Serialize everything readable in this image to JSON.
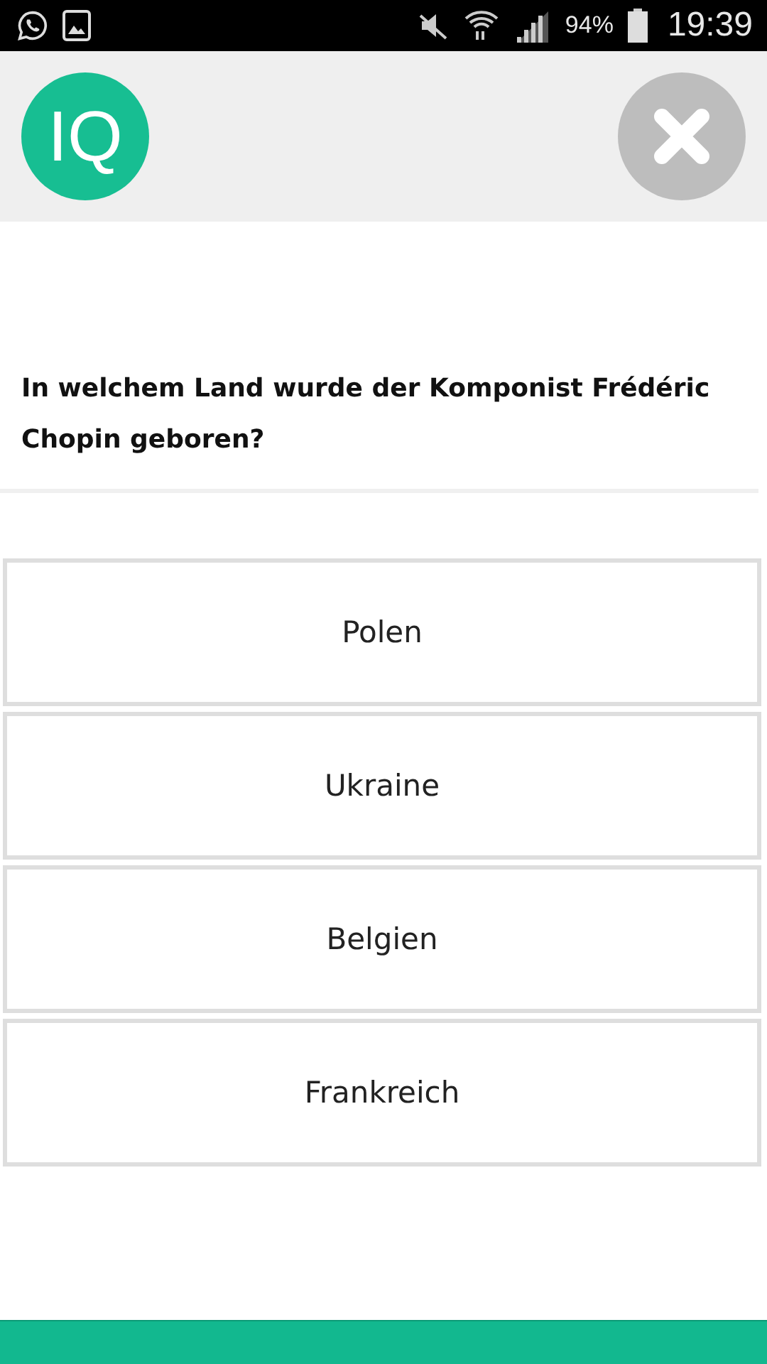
{
  "status_bar": {
    "battery": "94%",
    "time": "19:39"
  },
  "header": {
    "logo": "IQ"
  },
  "question": "In welchem Land wurde der Komponist Frédéric Chopin geboren?",
  "answers": [
    "Polen",
    "Ukraine",
    "Belgien",
    "Frankreich"
  ]
}
